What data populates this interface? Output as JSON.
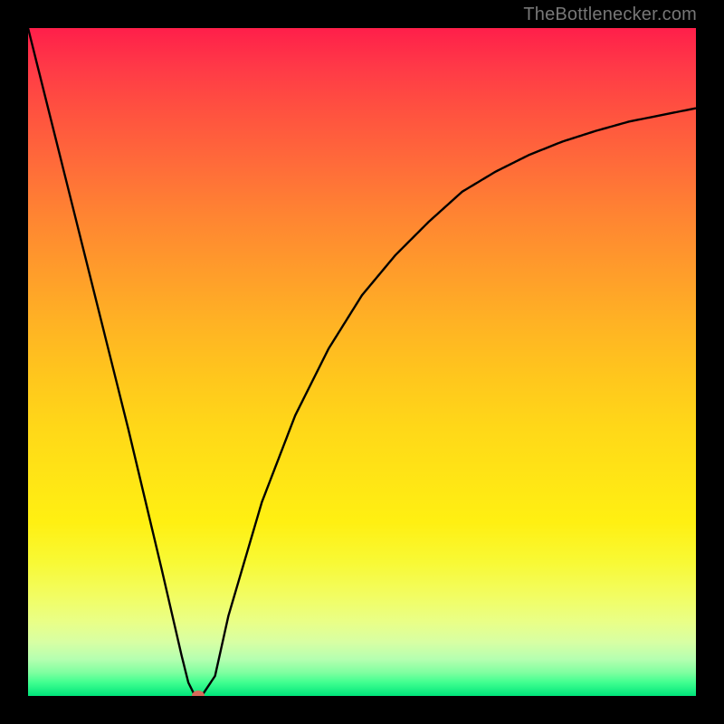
{
  "attribution": "TheBottlenecker.com",
  "chart_data": {
    "type": "line",
    "title": "",
    "xlabel": "",
    "ylabel": "",
    "xlim": [
      0,
      100
    ],
    "ylim": [
      0,
      100
    ],
    "x": [
      0,
      5,
      10,
      15,
      20,
      23,
      24,
      25,
      26,
      28,
      30,
      35,
      40,
      45,
      50,
      55,
      60,
      65,
      70,
      75,
      80,
      85,
      90,
      95,
      100
    ],
    "y": [
      100,
      80,
      60,
      40,
      19,
      6,
      2,
      0,
      0,
      3,
      12,
      29,
      42,
      52,
      60,
      66,
      71,
      75.5,
      78.5,
      81,
      83,
      84.6,
      86,
      87,
      88
    ],
    "notes": "V-shaped bottleneck curve; minimum (optimal point) near x≈25. Left branch is steep linear descent from 100→0; right branch rises with diminishing return toward ~88.",
    "marker": {
      "x": 25.5,
      "y": 0
    },
    "background": "vertical rainbow gradient red→orange→yellow→green"
  },
  "marker_color": "#d86a5a",
  "curve_color": "#000000"
}
